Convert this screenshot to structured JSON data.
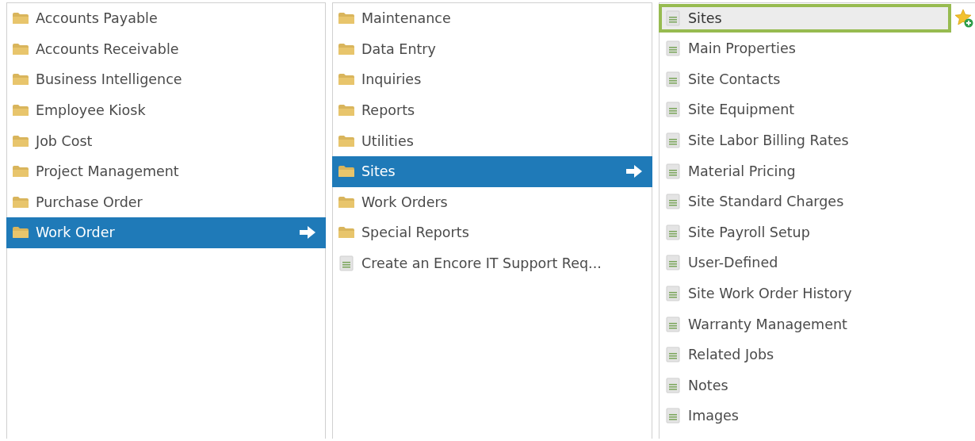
{
  "columns": [
    {
      "items": [
        {
          "label": "Accounts Payable",
          "kind": "folder",
          "selected": false
        },
        {
          "label": "Accounts Receivable",
          "kind": "folder",
          "selected": false
        },
        {
          "label": "Business Intelligence",
          "kind": "folder",
          "selected": false
        },
        {
          "label": "Employee Kiosk",
          "kind": "folder",
          "selected": false
        },
        {
          "label": "Job Cost",
          "kind": "folder",
          "selected": false
        },
        {
          "label": "Project Management",
          "kind": "folder",
          "selected": false
        },
        {
          "label": "Purchase Order",
          "kind": "folder",
          "selected": false
        },
        {
          "label": "Work Order",
          "kind": "folder",
          "selected": true
        }
      ]
    },
    {
      "items": [
        {
          "label": "Maintenance",
          "kind": "folder",
          "selected": false
        },
        {
          "label": "Data Entry",
          "kind": "folder",
          "selected": false
        },
        {
          "label": "Inquiries",
          "kind": "folder",
          "selected": false
        },
        {
          "label": "Reports",
          "kind": "folder",
          "selected": false
        },
        {
          "label": "Utilities",
          "kind": "folder",
          "selected": false
        },
        {
          "label": "Sites",
          "kind": "folder",
          "selected": true
        },
        {
          "label": "Work Orders",
          "kind": "folder",
          "selected": false
        },
        {
          "label": "Special Reports",
          "kind": "folder",
          "selected": false
        },
        {
          "label": "Create an Encore IT Support Req...",
          "kind": "document",
          "selected": false
        }
      ]
    },
    {
      "items": [
        {
          "label": "Sites",
          "kind": "document",
          "selected": false,
          "highlighted": true
        },
        {
          "label": "Main Properties",
          "kind": "document",
          "selected": false,
          "highlighted": false
        },
        {
          "label": "Site Contacts",
          "kind": "document",
          "selected": false,
          "highlighted": false
        },
        {
          "label": "Site Equipment",
          "kind": "document",
          "selected": false,
          "highlighted": false
        },
        {
          "label": "Site Labor Billing Rates",
          "kind": "document",
          "selected": false,
          "highlighted": false
        },
        {
          "label": "Material Pricing",
          "kind": "document",
          "selected": false,
          "highlighted": false
        },
        {
          "label": "Site Standard Charges",
          "kind": "document",
          "selected": false,
          "highlighted": false
        },
        {
          "label": "Site Payroll Setup",
          "kind": "document",
          "selected": false,
          "highlighted": false
        },
        {
          "label": "User-Defined",
          "kind": "document",
          "selected": false,
          "highlighted": false
        },
        {
          "label": "Site Work Order History",
          "kind": "document",
          "selected": false,
          "highlighted": false
        },
        {
          "label": "Warranty Management",
          "kind": "document",
          "selected": false,
          "highlighted": false
        },
        {
          "label": "Related Jobs",
          "kind": "document",
          "selected": false,
          "highlighted": false
        },
        {
          "label": "Notes",
          "kind": "document",
          "selected": false,
          "highlighted": false
        },
        {
          "label": "Images",
          "kind": "document",
          "selected": false,
          "highlighted": false
        }
      ]
    }
  ]
}
